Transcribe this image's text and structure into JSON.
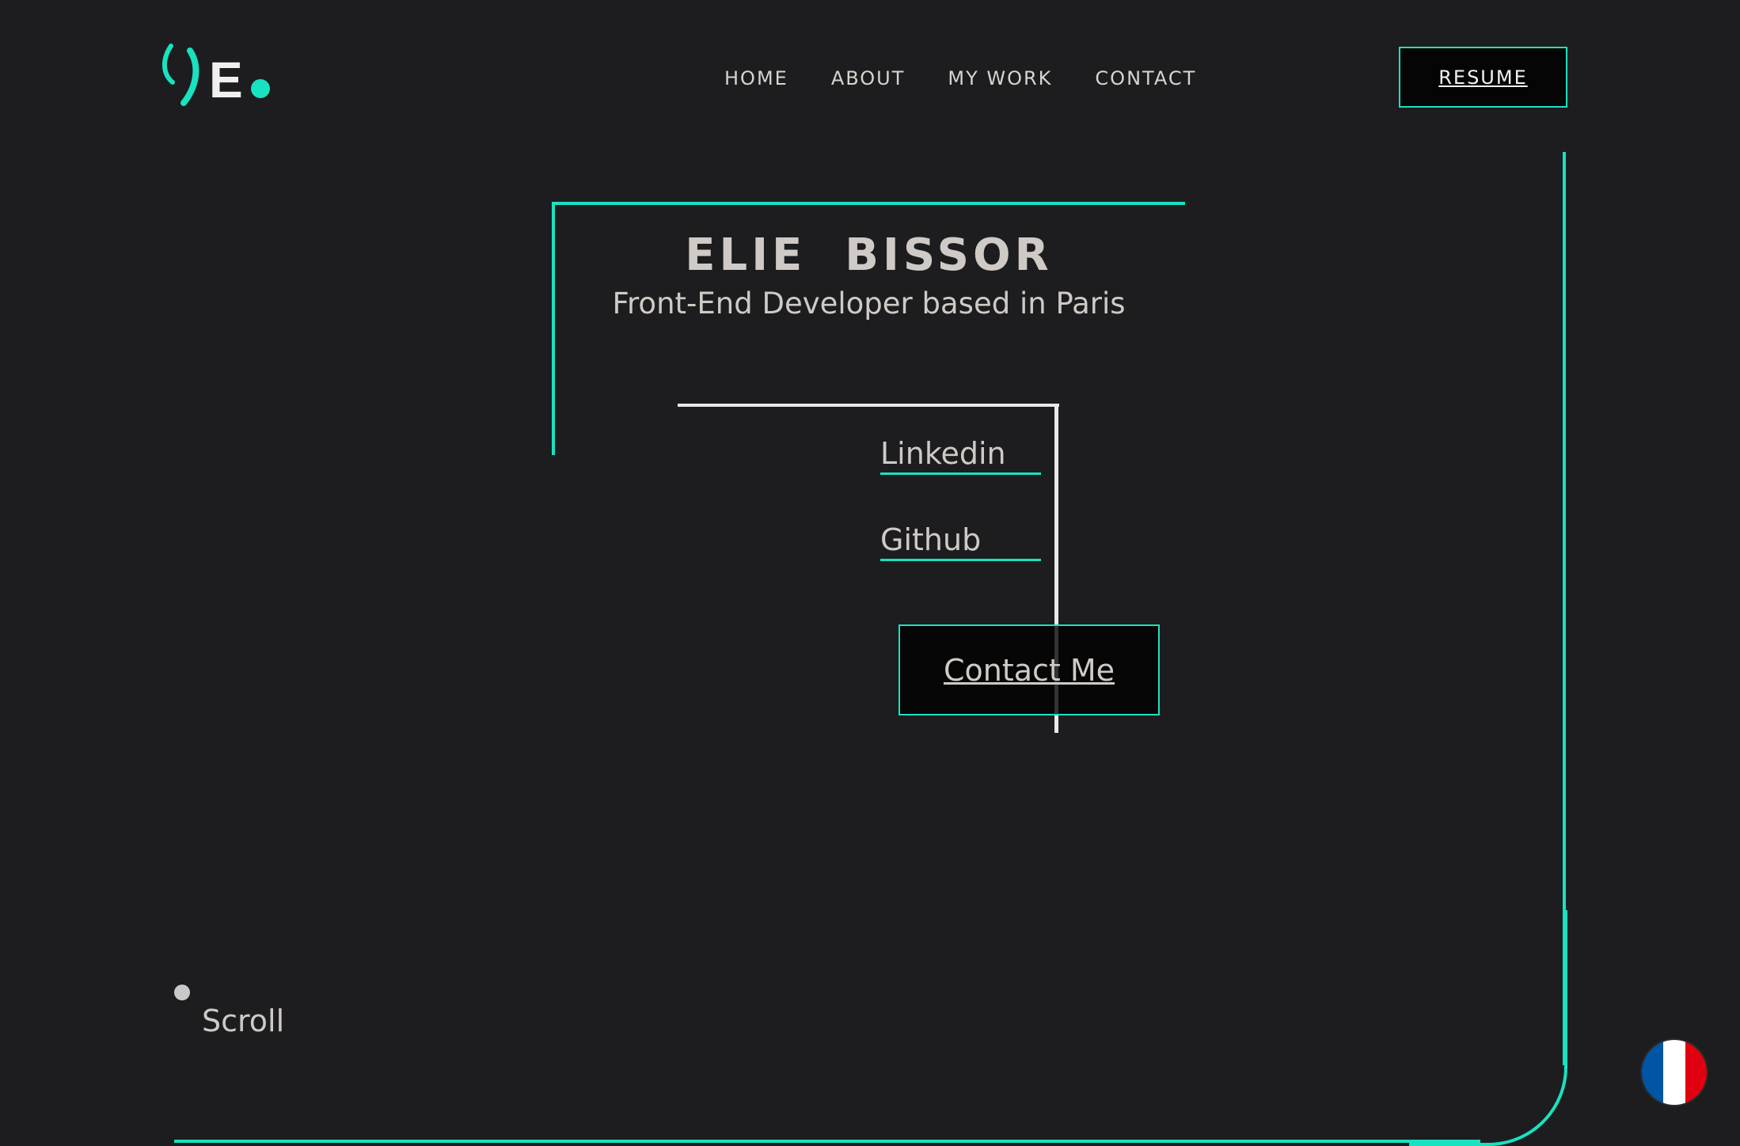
{
  "brand": {
    "logo_letter": "E",
    "accent_color": "#18e2c0",
    "background_color": "#1d1d1f"
  },
  "nav": {
    "items": [
      {
        "label": "HOME"
      },
      {
        "label": "ABOUT"
      },
      {
        "label": "MY WORK"
      },
      {
        "label": "CONTACT"
      }
    ],
    "resume_label": "RESUME"
  },
  "hero": {
    "name": "ELIE  BISSOR",
    "tagline": "Front-End Developer based in Paris",
    "links": [
      {
        "label": "Linkedin"
      },
      {
        "label": "Github"
      }
    ],
    "cta_label": "Contact Me"
  },
  "scroll_label": "Scroll",
  "language": {
    "flag_icon": "france-flag-icon",
    "flag_colors": [
      "#0055a4",
      "#ffffff",
      "#e1000f"
    ]
  }
}
